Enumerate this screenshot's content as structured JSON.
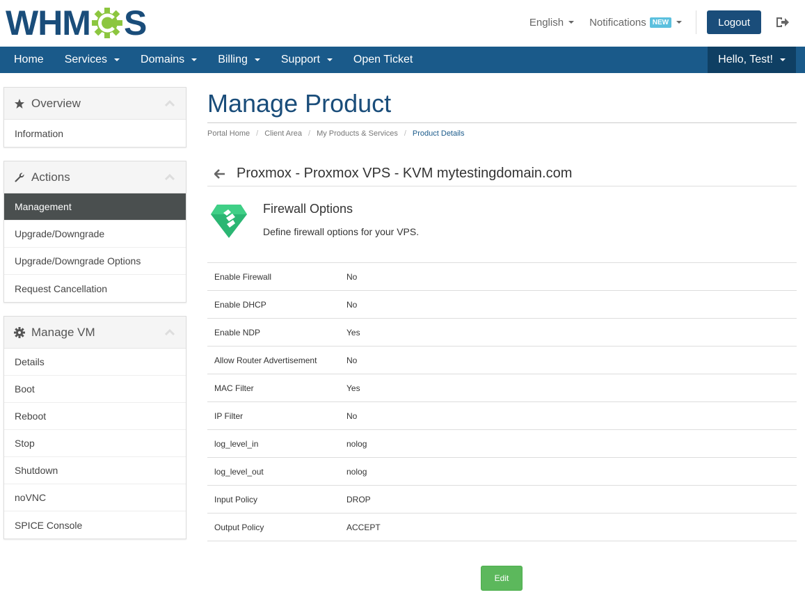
{
  "logo": {
    "text_left": "WHM",
    "text_right": "S"
  },
  "top": {
    "language": "English",
    "notifications": "Notifications",
    "notifications_badge": "NEW",
    "logout": "Logout"
  },
  "nav": {
    "items": [
      {
        "label": "Home",
        "dropdown": false
      },
      {
        "label": "Services",
        "dropdown": true
      },
      {
        "label": "Domains",
        "dropdown": true
      },
      {
        "label": "Billing",
        "dropdown": true
      },
      {
        "label": "Support",
        "dropdown": true
      },
      {
        "label": "Open Ticket",
        "dropdown": false
      }
    ],
    "user": "Hello, Test!"
  },
  "sidebar": {
    "overview": {
      "title": "Overview",
      "items": [
        "Information"
      ]
    },
    "actions": {
      "title": "Actions",
      "items": [
        "Management",
        "Upgrade/Downgrade",
        "Upgrade/Downgrade Options",
        "Request Cancellation"
      ],
      "active": "Management"
    },
    "manage_vm": {
      "title": "Manage VM",
      "items": [
        "Details",
        "Boot",
        "Reboot",
        "Stop",
        "Shutdown",
        "noVNC",
        "SPICE Console"
      ]
    }
  },
  "main": {
    "title": "Manage Product",
    "breadcrumb": [
      "Portal Home",
      "Client Area",
      "My Products & Services",
      "Product Details"
    ],
    "product_title": "Proxmox - Proxmox VPS - KVM mytestingdomain.com",
    "firewall_title": "Firewall Options",
    "firewall_desc": "Define firewall options for your VPS.",
    "options": [
      {
        "label": "Enable Firewall",
        "value": "No"
      },
      {
        "label": "Enable DHCP",
        "value": "No"
      },
      {
        "label": "Enable NDP",
        "value": "Yes"
      },
      {
        "label": "Allow Router Advertisement",
        "value": "No"
      },
      {
        "label": "MAC Filter",
        "value": "Yes"
      },
      {
        "label": "IP Filter",
        "value": "No"
      },
      {
        "label": "log_level_in",
        "value": "nolog"
      },
      {
        "label": "log_level_out",
        "value": "nolog"
      },
      {
        "label": "Input Policy",
        "value": "DROP"
      },
      {
        "label": "Output Policy",
        "value": "ACCEPT"
      }
    ],
    "edit_label": "Edit"
  },
  "colors": {
    "brand_blue": "#1a4d7a",
    "nav_blue": "#1a5a8a",
    "logo_green": "#8cc63f",
    "active_item": "#4a4f4f",
    "edit_green": "#5cb85c"
  }
}
